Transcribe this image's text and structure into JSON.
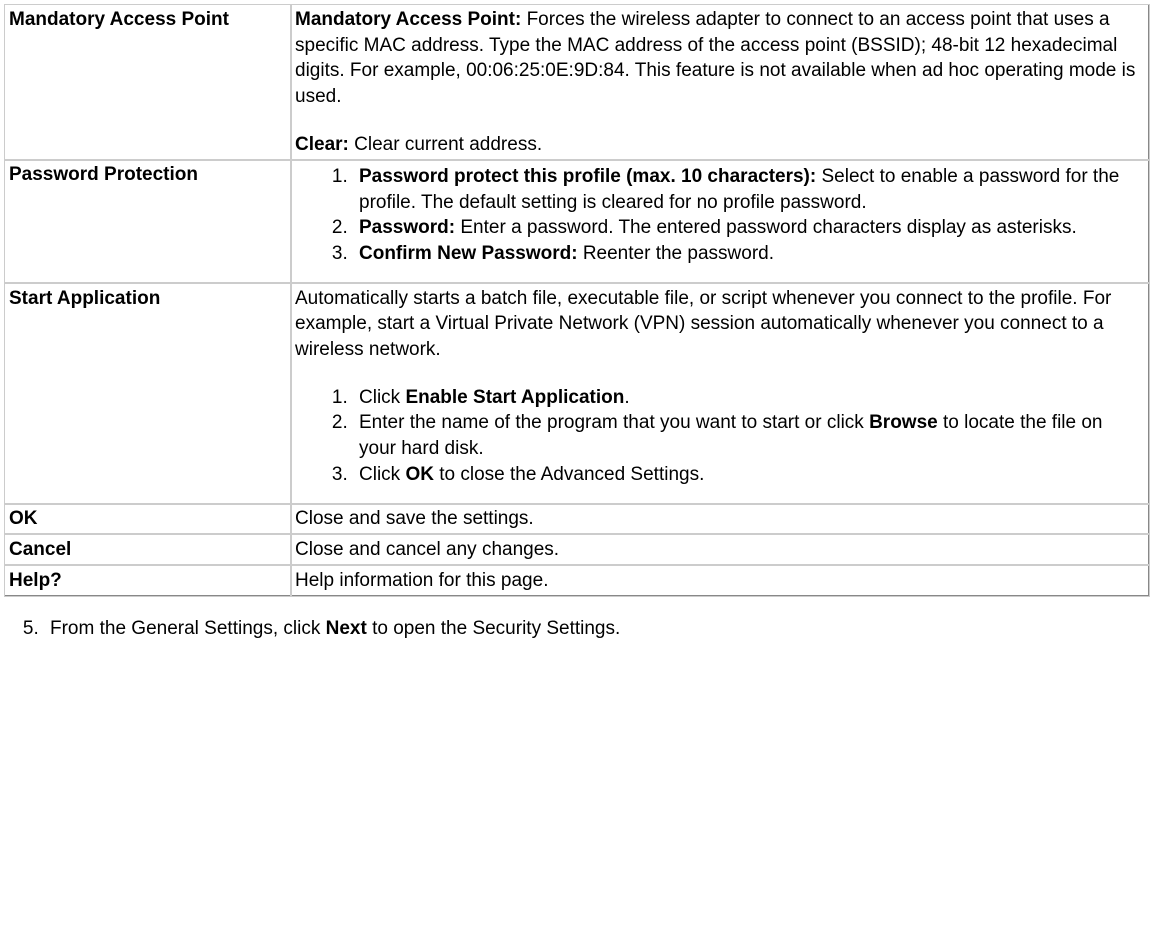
{
  "rows": {
    "mandatory_access_point": {
      "label": "Mandatory Access Point",
      "desc_bold_label": "Mandatory Access Point:",
      "desc_text": " Forces the wireless adapter to connect to an access point that uses a specific MAC address. Type the MAC address of the access point (BSSID); 48-bit 12 hexadecimal digits. For example, 00:06:25:0E:9D:84. This feature is not available when ad hoc operating mode is used.",
      "clear_bold": "Clear:",
      "clear_text": " Clear current address."
    },
    "password_protection": {
      "label": "Password Protection",
      "item1_bold": "Password protect this profile (max. 10 characters):",
      "item1_text": " Select to enable a password for the profile. The default setting is cleared for no profile password.",
      "item2_bold": "Password:",
      "item2_text": " Enter a password. The entered password characters display as asterisks.",
      "item3_bold": "Confirm New Password:",
      "item3_text": " Reenter the password."
    },
    "start_application": {
      "label": "Start Application",
      "intro": "Automatically starts a batch file, executable file, or script whenever you connect to the profile. For example, start a Virtual Private Network (VPN) session automatically whenever you connect to a wireless network.",
      "item1_pre": "Click ",
      "item1_bold": "Enable Start Application",
      "item1_post": ".",
      "item2_pre": "Enter the name of the program that you want to start or click ",
      "item2_bold": "Browse",
      "item2_post": " to locate the file on your hard disk.",
      "item3_pre": "Click ",
      "item3_bold": "OK",
      "item3_post": " to close the Advanced Settings."
    },
    "ok": {
      "label": "OK",
      "desc": "Close and save the settings."
    },
    "cancel": {
      "label": "Cancel",
      "desc": "Close and cancel any changes."
    },
    "help": {
      "label": "Help?",
      "desc": "Help information for this page."
    }
  },
  "footer": {
    "prefix": "From the General Settings, click ",
    "bold": "Next",
    "suffix": " to open the Security Settings."
  }
}
